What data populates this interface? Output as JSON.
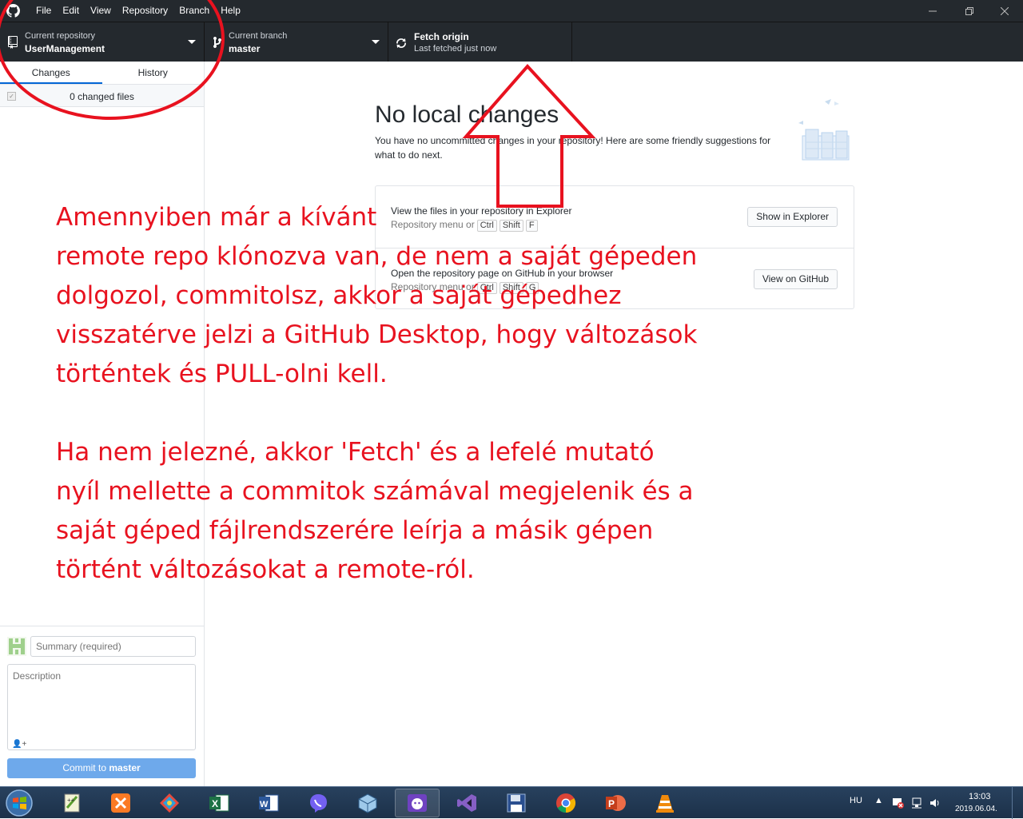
{
  "menu": [
    "File",
    "Edit",
    "View",
    "Repository",
    "Branch",
    "Help"
  ],
  "toolbar": {
    "repo_label": "Current repository",
    "repo_value": "UserManagement",
    "branch_label": "Current branch",
    "branch_value": "master",
    "fetch_label": "Fetch origin",
    "fetch_status": "Last fetched just now"
  },
  "sidebar": {
    "tabs": [
      "Changes",
      "History"
    ],
    "changed_files": "0 changed files",
    "summary_placeholder": "Summary (required)",
    "description_placeholder": "Description",
    "commit_prefix": "Commit to ",
    "commit_branch": "master"
  },
  "main": {
    "title": "No local changes",
    "subtitle": "You have no uncommitted changes in your repository! Here are some friendly suggestions for what to do next.",
    "suggestions": [
      {
        "title": "View the files in your repository in Explorer",
        "hint": "Repository menu or",
        "keys": [
          "Ctrl",
          "Shift",
          "F"
        ],
        "button": "Show in Explorer"
      },
      {
        "title": "Open the repository page on GitHub in your browser",
        "hint": "Repository menu or",
        "keys": [
          "Ctrl",
          "Shift",
          "G"
        ],
        "button": "View on GitHub"
      }
    ]
  },
  "annotation": {
    "paragraph1": "Amennyiben már a kívánt\nremote repo klónozva van, de nem a saját gépeden\ndolgozol, commitolsz, akkor a saját gépedhez\nvisszatérve jelzi a GitHub Desktop, hogy változások\ntörténtek és PULL-olni kell.",
    "paragraph2": "Ha nem jelezné, akkor 'Fetch' és a lefelé mutató\nnyíl mellette a commitok számával megjelenik és a\nsaját géped fájlrendszerére leírja a másik gépen\ntörtént változásokat a remote-ról.",
    "color": "#e8121f"
  },
  "taskbar": {
    "language": "HU",
    "time": "13:03",
    "date": "2019.06.04.",
    "apps": [
      "notepad-plus-plus",
      "xampp",
      "tool",
      "excel",
      "word",
      "viber",
      "virtualbox",
      "github-desktop",
      "visual-studio",
      "save-disk",
      "chrome",
      "powerpoint",
      "vlc"
    ]
  }
}
